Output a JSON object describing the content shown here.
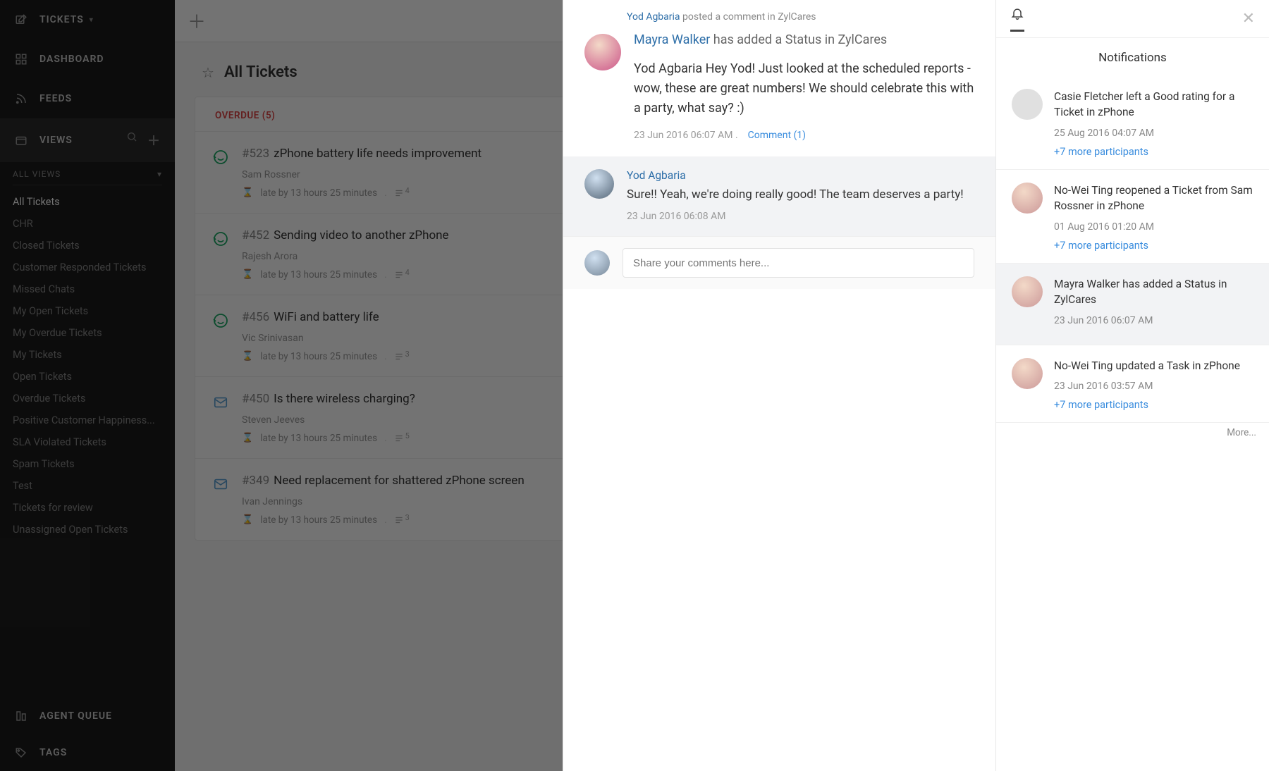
{
  "sidebar": {
    "tickets_label": "TICKETS",
    "dashboard_label": "DASHBOARD",
    "feeds_label": "FEEDS",
    "views_label": "VIEWS",
    "all_views_label": "ALL VIEWS",
    "views": [
      "All Tickets",
      "CHR",
      "Closed Tickets",
      "Customer Responded Tickets",
      "Missed Chats",
      "My Open Tickets",
      "My Overdue Tickets",
      "My Tickets",
      "Open Tickets",
      "Overdue Tickets",
      "Positive Customer Happiness...",
      "SLA Violated Tickets",
      "Spam Tickets",
      "Test",
      "Tickets for review",
      "Unassigned Open Tickets"
    ],
    "agent_queue_label": "AGENT QUEUE",
    "tags_label": "TAGS"
  },
  "page": {
    "title": "All Tickets",
    "overdue_label": "OVERDUE (5)",
    "tickets": [
      {
        "id": "#523",
        "title": "zPhone battery life needs improvement",
        "owner": "Sam Rossner",
        "late": "late by 13 hours 25 minutes",
        "threads": "4",
        "kind": "happy"
      },
      {
        "id": "#452",
        "title": "Sending video to another zPhone",
        "owner": "Rajesh Arora",
        "late": "late by 13 hours 25 minutes",
        "threads": "4",
        "kind": "happy"
      },
      {
        "id": "#456",
        "title": "WiFi and battery life",
        "owner": "Vic Srinivasan",
        "late": "late by 13 hours 25 minutes",
        "threads": "3",
        "kind": "happy"
      },
      {
        "id": "#450",
        "title": "Is there wireless charging?",
        "owner": "Steven Jeeves",
        "late": "late by 13 hours 25 minutes",
        "threads": "5",
        "kind": "mail"
      },
      {
        "id": "#349",
        "title": "Need replacement for shattered zPhone screen",
        "owner": "Ivan Jennings",
        "late": "late by 13 hours 25 minutes",
        "threads": "3",
        "kind": "mail"
      }
    ]
  },
  "conversation": {
    "crumb_name": "Yod Agbaria",
    "crumb_rest": " posted a comment in ZylCares",
    "headline_name": "Mayra Walker",
    "headline_rest": " has added a Status in ZylCares",
    "msg_name": "Yod Agbaria",
    "msg_body": " Hey Yod! Just looked at the scheduled reports - wow, these are great numbers! We should celebrate this with a party, what say? :)",
    "timestamp": "23 Jun 2016 06:07 AM .",
    "comment_link": "Comment (1)",
    "reply_name": "Yod Agbaria",
    "reply_body": "Sure!! Yeah, we're doing really good! The team deserves a party!",
    "reply_ts": "23 Jun 2016 06:08 AM",
    "compose_placeholder": "Share your comments here..."
  },
  "notifications": {
    "title": "Notifications",
    "items": [
      {
        "text": "Casie Fletcher left a Good rating for a Ticket in zPhone",
        "ts": "25 Aug 2016 04:07 AM",
        "more": "+7 more participants",
        "avatar": "grey"
      },
      {
        "text": "No-Wei Ting reopened a Ticket from Sam Rossner in zPhone",
        "ts": "01 Aug 2016 01:20 AM",
        "more": "+7 more participants",
        "avatar": "color"
      },
      {
        "text": "Mayra Walker has added a Status in ZylCares",
        "ts": "23 Jun 2016 06:07 AM",
        "more": "",
        "avatar": "color",
        "selected": true
      },
      {
        "text": "No-Wei Ting updated a Task in zPhone",
        "ts": "23 Jun 2016 03:57 AM",
        "more": "+7 more participants",
        "avatar": "color"
      }
    ],
    "more_label": "More..."
  }
}
